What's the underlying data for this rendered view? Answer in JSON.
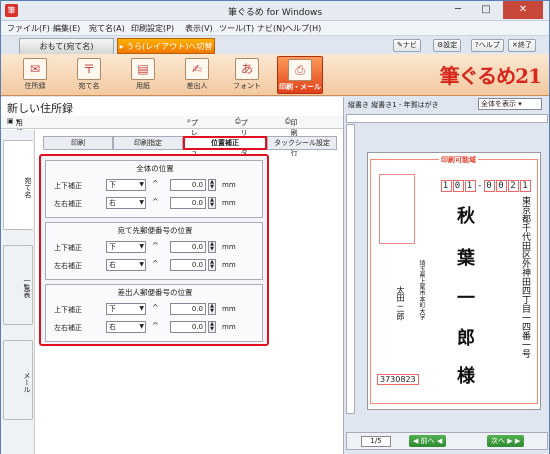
{
  "app": {
    "title": "筆ぐるめ for Windows"
  },
  "menu": [
    "ファイル(F)",
    "編集(E)",
    "宛て名(A)",
    "印刷設定(P)",
    "表示(V)",
    "ツール(T)",
    "ナビ(N)",
    "ヘルプ(H)"
  ],
  "tabs": {
    "omote": "おもて(宛て名)",
    "ura": "うら(レイアウト)へ切替"
  },
  "topbuttons": {
    "navi": "ナビ",
    "settings": "設定",
    "help": "ヘルプ",
    "exit": "終了"
  },
  "toolbar": {
    "items": [
      "住所録",
      "宛て名",
      "用紙",
      "差出人",
      "フォント",
      "印刷・メール"
    ],
    "logo": "筆ぐるめ21"
  },
  "left": {
    "title": "新しい住所録",
    "save_style": "用紙スタイル保存",
    "preview": "プレビュー",
    "printer": "プリンター設定",
    "print_exec": "印刷実行",
    "side_tabs": [
      "宛て名",
      "一覧表",
      "メール"
    ],
    "inner_tabs": [
      "印刷",
      "印刷指定",
      "位置補正",
      "タックシール設定"
    ],
    "groups": [
      {
        "title": "全体の位置",
        "rows": [
          {
            "label": "上下補正",
            "dir": "下",
            "value": "0.0",
            "unit": "mm"
          },
          {
            "label": "左右補正",
            "dir": "右",
            "value": "0.0",
            "unit": "mm"
          }
        ]
      },
      {
        "title": "宛て先郵便番号の位置",
        "rows": [
          {
            "label": "上下補正",
            "dir": "下",
            "value": "0.0",
            "unit": "mm"
          },
          {
            "label": "左右補正",
            "dir": "右",
            "value": "0.0",
            "unit": "mm"
          }
        ]
      },
      {
        "title": "差出人郵便番号の位置",
        "rows": [
          {
            "label": "上下補正",
            "dir": "下",
            "value": "0.0",
            "unit": "mm"
          },
          {
            "label": "左右補正",
            "dir": "右",
            "value": "0.0",
            "unit": "mm"
          }
        ]
      }
    ]
  },
  "right": {
    "header": "縦書き 縦書き1 - 年賀はがき",
    "view": "全体を表示",
    "printable": "印刷可能域",
    "zip": [
      "1",
      "0",
      "1",
      "0",
      "0",
      "2",
      "1"
    ],
    "address": "東京都千代田区外神田四丁目一四番一号",
    "name1": "秋",
    "name2": "葉",
    "name3": "一",
    "name4": "郎",
    "honorific": "様",
    "sender_address": "埼玉県上尾市本町大字",
    "sender_name": "太田 二郎",
    "sender_zip": "3730823",
    "page": "1/5",
    "prev": "前へ",
    "next": "次へ"
  }
}
